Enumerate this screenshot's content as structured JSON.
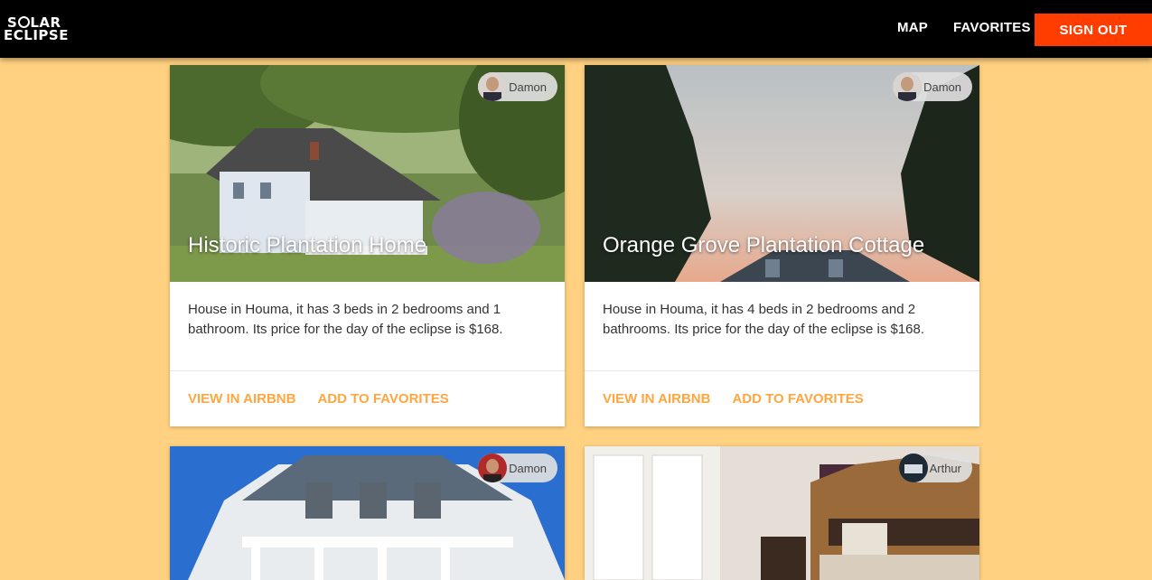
{
  "appbar": {
    "logo_line1_pre": "S",
    "logo_line1_post": "LAR",
    "logo_line2": "ECLIPSE",
    "nav_map": "MAP",
    "nav_favorites": "FAVORITES",
    "sign_out": "SIGN OUT"
  },
  "colors": {
    "background": "#ffd180",
    "appbar": "#000000",
    "sign_out": "#ff3d00",
    "action_text": "#ffa640"
  },
  "cards": [
    {
      "title": "Historic Plantation Home",
      "host": "Damon",
      "description": "House in Houma, it has 3 beds in 2 bedrooms and 1 bathroom. Its price for the day of the eclipse is $168.",
      "action_view": "VIEW IN AIRBNB",
      "action_favorite": "ADD TO FAVORITES"
    },
    {
      "title": "Orange Grove Plantation Cottage",
      "host": "Damon",
      "description": "House in Houma, it has 4 beds in 2 bedrooms and 2 bathrooms. Its price for the day of the eclipse is $168.",
      "action_view": "VIEW IN AIRBNB",
      "action_favorite": "ADD TO FAVORITES"
    },
    {
      "host": "Damon"
    },
    {
      "host": "Arthur"
    }
  ]
}
